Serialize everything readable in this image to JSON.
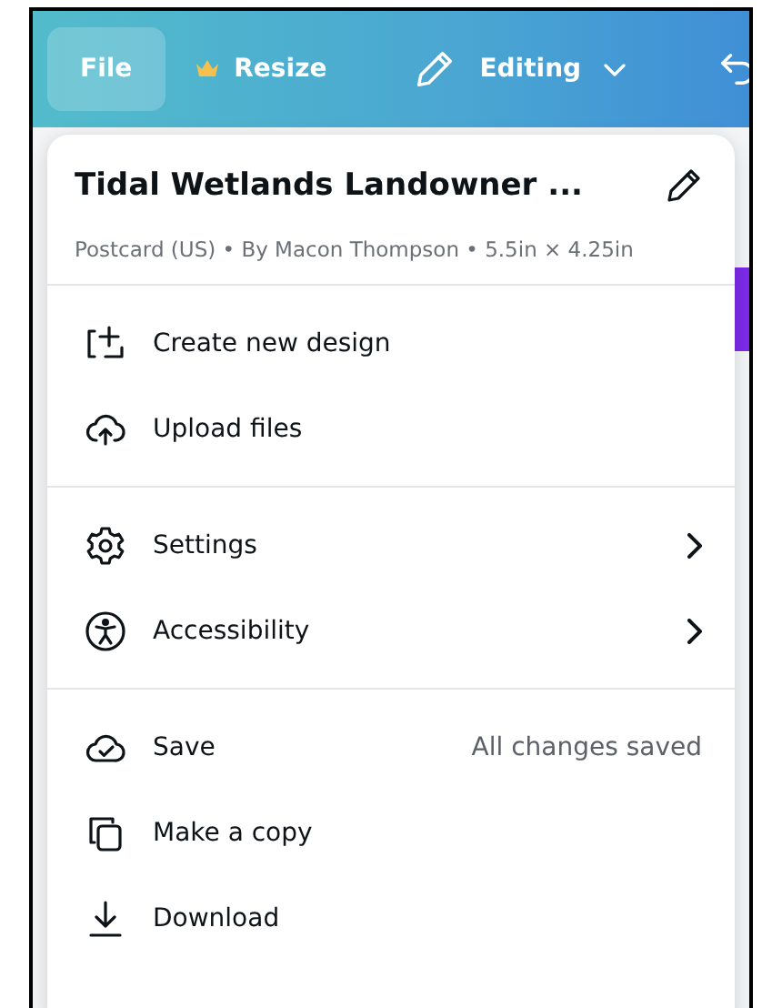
{
  "toolbar": {
    "buttons": [
      {
        "label": "File",
        "kind": "file",
        "selected": true
      },
      {
        "label": "Resize",
        "kind": "resize",
        "selected": false
      },
      {
        "label": "Editing",
        "kind": "editing",
        "selected": false
      }
    ]
  },
  "menu": {
    "title": "Tidal Wetlands Landowner ...",
    "meta": "Postcard (US) • By Macon Thompson • 5.5in × 4.25in",
    "sections": [
      {
        "items": [
          {
            "label": "Create new design",
            "kind": "create",
            "submenu": false
          },
          {
            "label": "Upload files",
            "kind": "upload",
            "submenu": false
          }
        ]
      },
      {
        "items": [
          {
            "label": "Settings",
            "kind": "settings",
            "submenu": true
          },
          {
            "label": "Accessibility",
            "kind": "accessibility",
            "submenu": true
          }
        ]
      },
      {
        "items": [
          {
            "label": "Save",
            "kind": "save",
            "submenu": false,
            "status": "All changes saved"
          },
          {
            "label": "Make a copy",
            "kind": "copy",
            "submenu": false
          },
          {
            "label": "Download",
            "kind": "download",
            "submenu": false
          }
        ]
      }
    ]
  }
}
